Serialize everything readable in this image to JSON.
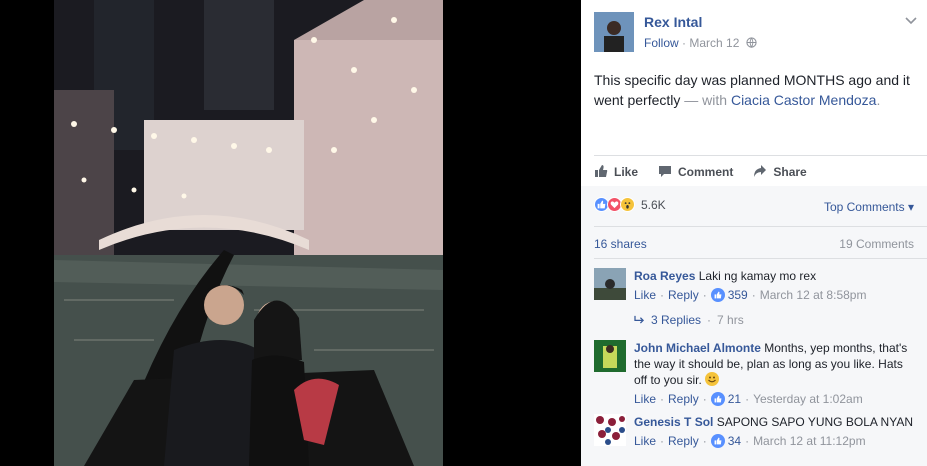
{
  "post": {
    "author": "Rex Intal",
    "follow_label": "Follow",
    "date": "March 12",
    "text": "This specific day was planned MONTHS ago and it went perfectly",
    "with_text": " — with ",
    "tagged": "Ciacia Castor Mendoza",
    "tagged_suffix": "."
  },
  "actions": {
    "like": "Like",
    "comment": "Comment",
    "share": "Share"
  },
  "reactions": {
    "count": "5.6K",
    "sort_label": "Top Comments",
    "shares": "16 shares",
    "comments": "19 Comments"
  },
  "comments": [
    {
      "name": "Roa Reyes",
      "text": "Laki ng kamay mo rex",
      "like": "Like",
      "reply": "Reply",
      "likes": "359",
      "time": "March 12 at 8:58pm"
    },
    {
      "name": "John Michael Almonte",
      "text": "Months, yep months, that's the way it should be, plan as long as you like. Hats off to you sir.",
      "like": "Like",
      "reply": "Reply",
      "likes": "21",
      "time": "Yesterday at 1:02am"
    },
    {
      "name": "Genesis T Sol",
      "text": "SAPONG SAPO YUNG BOLA NYAN",
      "like": "Like",
      "reply": "Reply",
      "likes": "34",
      "time": "March 12 at 11:12pm"
    }
  ],
  "replies": {
    "label": "3 Replies",
    "time": "7 hrs"
  },
  "colors": {
    "link": "#365899",
    "muted": "#90949c",
    "like_blue": "#5890ff",
    "love_red": "#f25268",
    "wow_yellow": "#f5c33b"
  },
  "icons": [
    "thumbs-up-icon",
    "comment-icon",
    "share-icon",
    "globe-icon",
    "chevron-down-icon",
    "reply-arrow-icon"
  ]
}
